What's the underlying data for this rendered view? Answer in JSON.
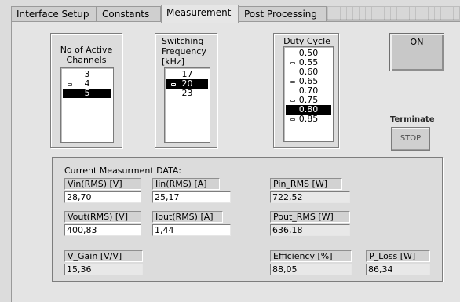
{
  "tabs": [
    {
      "label": "Interface Setup",
      "active": false
    },
    {
      "label": "Constants",
      "active": false
    },
    {
      "label": "Measurement",
      "active": true
    },
    {
      "label": "Post Processing",
      "active": false
    }
  ],
  "channels": {
    "title": "No of Active Channels",
    "items": [
      "3",
      "4",
      "5"
    ],
    "selected": "5",
    "marked": "4"
  },
  "frequency": {
    "title": "Switching Frequency [kHz]",
    "items": [
      "17",
      "20",
      "23"
    ],
    "selected": "20",
    "marked": "20"
  },
  "duty": {
    "title": "Duty Cycle",
    "items": [
      "0.50",
      "0.55",
      "0.60",
      "0.65",
      "0.70",
      "0.75",
      "0.80",
      "0.85"
    ],
    "selected": "0.80",
    "marked": [
      "0.55",
      "0.65",
      "0.75",
      "0.85"
    ]
  },
  "on_button": {
    "label": "ON"
  },
  "terminate": {
    "title": "Terminate",
    "stop_label": "STOP"
  },
  "measurement": {
    "header": "Current Measurment DATA:",
    "vin": {
      "label": "Vin(RMS) [V]",
      "value": "28,70"
    },
    "iin": {
      "label": "Iin(RMS) [A]",
      "value": "25,17"
    },
    "pin": {
      "label": "Pin_RMS [W]",
      "value": "722,52"
    },
    "vout": {
      "label": "Vout(RMS) [V]",
      "value": "400,83"
    },
    "iout": {
      "label": "Iout(RMS) [A]",
      "value": "1,44"
    },
    "pout": {
      "label": "Pout_RMS [W]",
      "value": "636,18"
    },
    "vgain": {
      "label": "V_Gain [V/V]",
      "value": "15,36"
    },
    "efficiency": {
      "label": "Efficiency [%]",
      "value": "88,05"
    },
    "ploss": {
      "label": "P_Loss [W]",
      "value": "86,34"
    }
  }
}
